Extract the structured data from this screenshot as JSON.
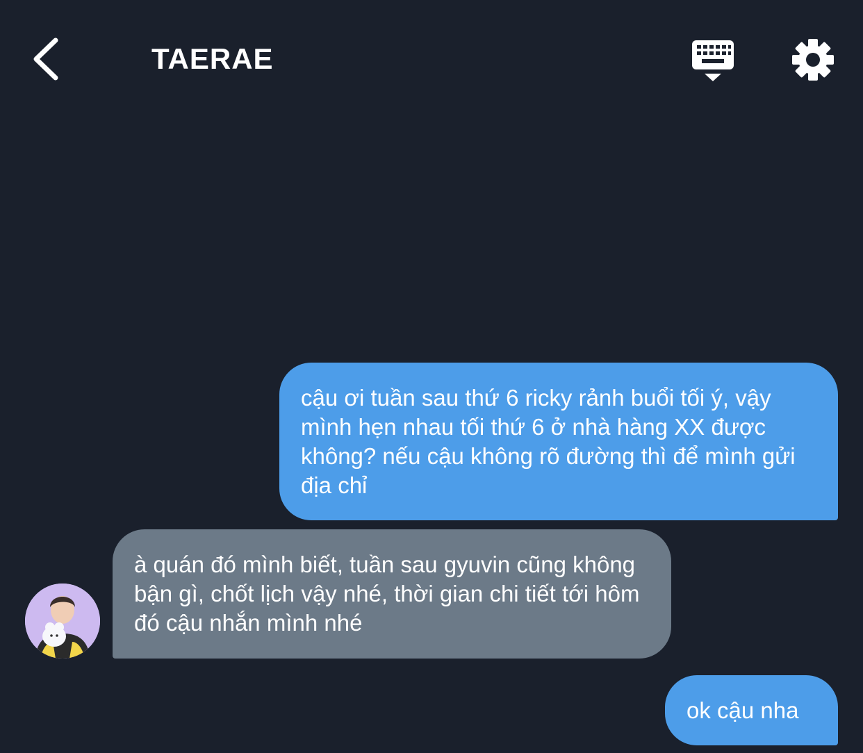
{
  "header": {
    "title": "TAERAE",
    "back_icon": "chevron-left-icon",
    "keyboard_icon": "keyboard-icon",
    "settings_icon": "gear-icon"
  },
  "messages": [
    {
      "direction": "sent",
      "text": "cậu ơi tuần sau thứ 6 ricky rảnh buổi tối ý, vậy mình hẹn nhau tối thứ 6 ở nhà hàng XX được không? nếu cậu không rõ đường thì để mình gửi địa chỉ"
    },
    {
      "direction": "received",
      "text": "à quán đó mình biết, tuần sau gyuvin cũng không bận gì, chốt lịch vậy nhé, thời gian chi tiết tới hôm đó cậu nhắn mình nhé"
    },
    {
      "direction": "sent",
      "text": "ok cậu nha"
    }
  ],
  "colors": {
    "background": "#1a202c",
    "sent_bubble": "#4d9de9",
    "received_bubble": "#6c7a88",
    "text": "#ffffff"
  }
}
